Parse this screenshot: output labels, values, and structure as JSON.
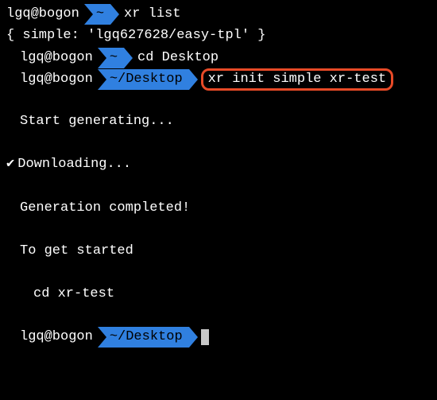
{
  "prompts": {
    "user_host": "lgq@bogon",
    "home": "~",
    "desktop": "~/Desktop"
  },
  "commands": {
    "cmd1": "xr list",
    "cmd2": "cd Desktop",
    "cmd3": "xr init simple xr-test"
  },
  "output": {
    "list_result": "{ simple: 'lgq627628/easy-tpl' }",
    "start": "Start generating...",
    "downloading": "Downloading...",
    "completed": "Generation completed!",
    "to_start": "To get started",
    "cd_hint": "cd xr-test"
  },
  "symbols": {
    "check": "✔"
  }
}
